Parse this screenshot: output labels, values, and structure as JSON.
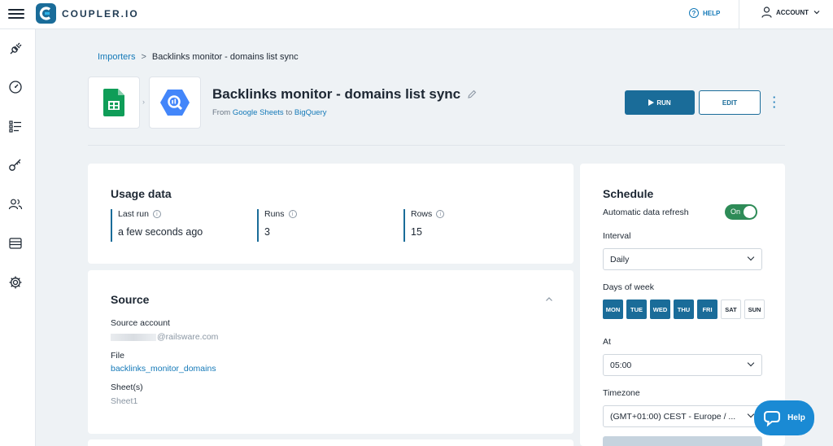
{
  "brand": {
    "name": "COUPLER.IO"
  },
  "topbar": {
    "help_label": "HELP",
    "help_icon_glyph": "?",
    "account_label": "ACCOUNT"
  },
  "breadcrumb": {
    "parent": "Importers",
    "separator": ">",
    "current": "Backlinks monitor - domains list sync"
  },
  "importer": {
    "title": "Backlinks monitor - domains list sync",
    "from_prefix": "From",
    "source": "Google Sheets",
    "to_word": "to",
    "destination": "BigQuery",
    "run_label": "RUN",
    "edit_label": "EDIT",
    "tile_arrow": "›"
  },
  "usage": {
    "title": "Usage data",
    "info_glyph": "i",
    "stats": [
      {
        "label": "Last run",
        "value": "a few seconds ago"
      },
      {
        "label": "Runs",
        "value": "3"
      },
      {
        "label": "Rows",
        "value": "15"
      }
    ]
  },
  "source_card": {
    "title": "Source",
    "account_label": "Source account",
    "account_value": "@railsware.com",
    "file_label": "File",
    "file_value": "backlinks_monitor_domains",
    "sheets_label": "Sheet(s)",
    "sheets_value": "Sheet1"
  },
  "schedule": {
    "title": "Schedule",
    "auto_refresh_label": "Automatic data refresh",
    "toggle_label": "On",
    "toggle_on": true,
    "interval_label": "Interval",
    "interval_value": "Daily",
    "days_label": "Days of week",
    "days": [
      {
        "label": "MON",
        "selected": true
      },
      {
        "label": "TUE",
        "selected": true
      },
      {
        "label": "WED",
        "selected": true
      },
      {
        "label": "THU",
        "selected": true
      },
      {
        "label": "FRI",
        "selected": true
      },
      {
        "label": "SAT",
        "selected": false
      },
      {
        "label": "SUN",
        "selected": false
      }
    ],
    "at_label": "At",
    "at_value": "05:00",
    "timezone_label": "Timezone",
    "timezone_value": "(GMT+01:00) CEST - Europe / ..."
  },
  "help_widget": {
    "label": "Help"
  },
  "colors": {
    "accent": "#1a6c99",
    "link": "#1479b8",
    "toggle_on": "#2e8b57",
    "help_fab": "#1a8ad4"
  },
  "icons": {
    "sidebar": [
      "plug-icon",
      "gauge-icon",
      "checklist-icon",
      "key-icon",
      "users-icon",
      "billing-icon",
      "gear-icon"
    ]
  }
}
